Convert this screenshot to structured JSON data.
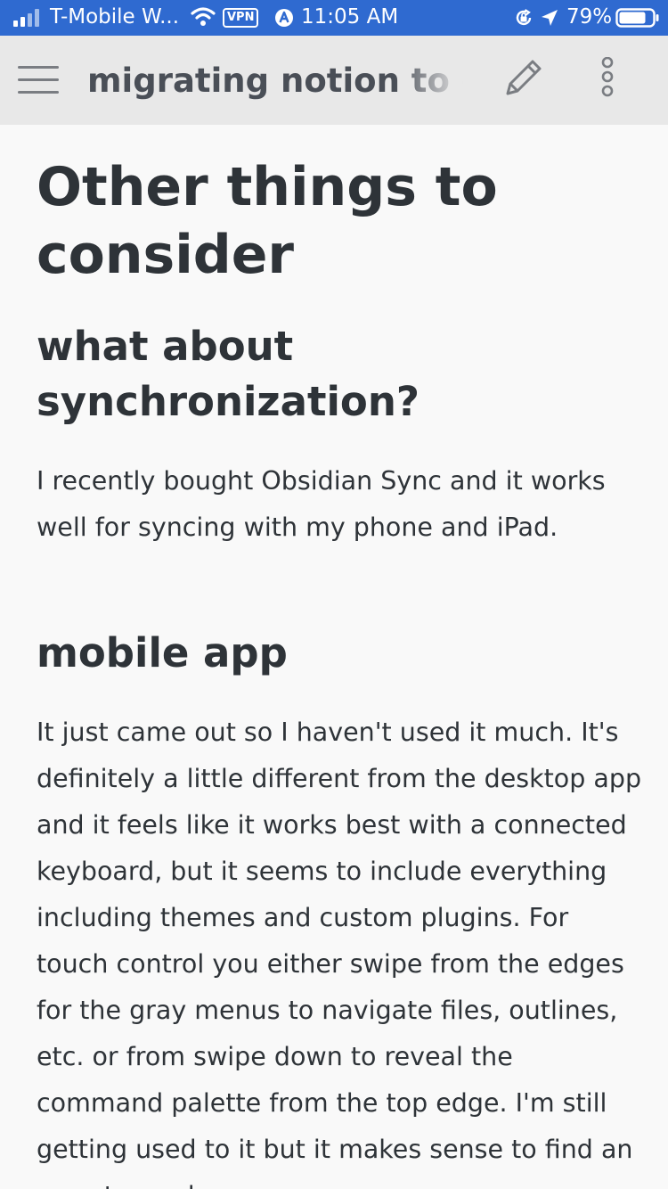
{
  "status_bar": {
    "carrier": "T-Mobile W...",
    "vpn_label": "VPN",
    "time": "11:05 AM",
    "battery": "79%",
    "icons": [
      "signal-icon",
      "wifi-icon",
      "vpn-icon",
      "location-a-icon",
      "rotation-lock-icon",
      "location-arrow-icon",
      "battery-icon"
    ],
    "battery_level": 0.79,
    "color": "#2f6ad0"
  },
  "header": {
    "title": "migrating notion to obsidian",
    "icons": [
      "hamburger-menu-icon",
      "pencil-icon",
      "more-vertical-icon"
    ]
  },
  "content": {
    "heading": "Other things to consider",
    "sections": [
      {
        "heading": "what about synchronization?",
        "paragraph": "I recently bought Obsidian Sync and it works well for syncing with my phone and iPad."
      },
      {
        "heading": "mobile app",
        "paragraph": "It just came out so I haven't used it much. It's definitely a little different from the desktop app and it feels like it works best with a connected keyboard, but it seems to include everything including themes and custom plugins. For touch control you either swipe from the edges for the gray menus to navigate files, outlines, etc. or from swipe down to reveal the command palette from the top edge. I'm still getting used to it but it makes sense to find an easy to read"
      }
    ]
  }
}
